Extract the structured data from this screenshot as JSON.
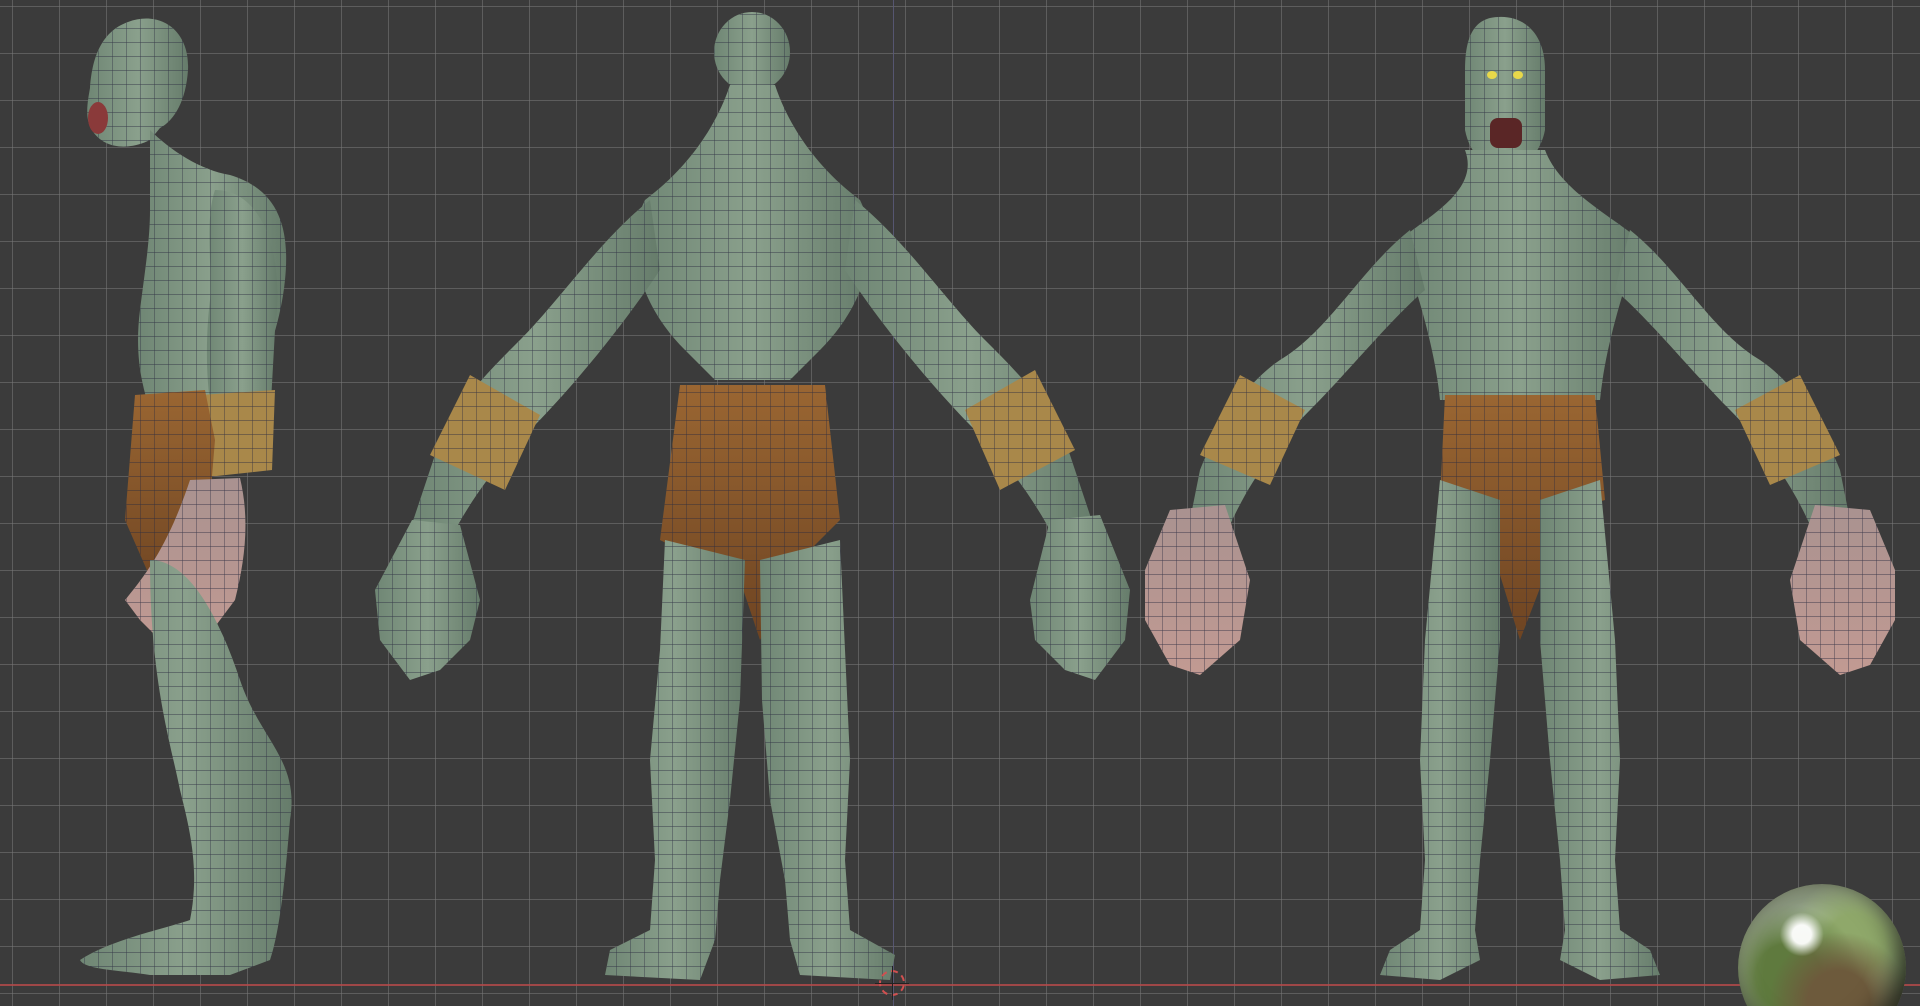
{
  "viewport": {
    "background": "#3b3b3b",
    "grid_color": "#787878",
    "ground_axis_color": "#b24a4a",
    "vertical_axis_color": "#5a5a78"
  },
  "character": {
    "skin_color": "#7f9683",
    "skin_dark": "#5c7061",
    "hands_color": "#b8958f",
    "cloth_color": "#8c5a2c",
    "band_color": "#a9884a",
    "wire_color": "#2a2a40",
    "eye_color": "#e8d84a",
    "views": [
      "side-view",
      "back-view",
      "front-view"
    ]
  },
  "icons": {
    "origin": "3d-cursor-icon",
    "hdri": "hdri-preview-sphere"
  }
}
